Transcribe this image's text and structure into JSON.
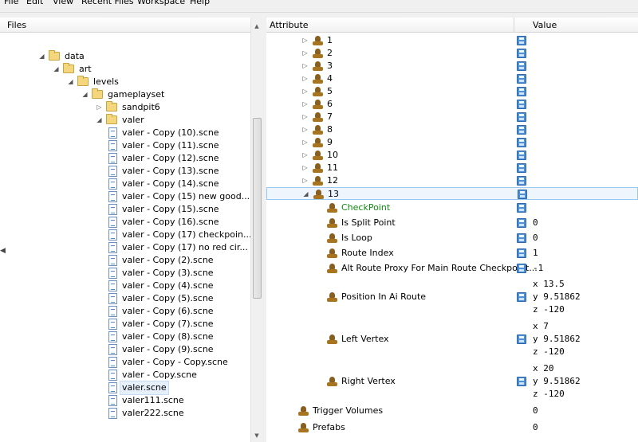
{
  "menubar": {
    "items": [
      "File",
      "Edit",
      "View",
      "Recent Files",
      "Workspace",
      "Help"
    ]
  },
  "files_panel": {
    "header": "Files",
    "tree": [
      {
        "label": "data",
        "type": "folder",
        "expanded": true
      },
      {
        "label": "art",
        "type": "folder",
        "expanded": true
      },
      {
        "label": "levels",
        "type": "folder",
        "expanded": true
      },
      {
        "label": "gameplayset",
        "type": "folder",
        "expanded": true
      },
      {
        "label": "sandpit6",
        "type": "folder",
        "expanded": false
      },
      {
        "label": "valer",
        "type": "folder",
        "expanded": true
      },
      {
        "label": "valer - Copy (10).scne",
        "type": "file"
      },
      {
        "label": "valer - Copy (11).scne",
        "type": "file"
      },
      {
        "label": "valer - Copy (12).scne",
        "type": "file"
      },
      {
        "label": "valer - Copy (13).scne",
        "type": "file"
      },
      {
        "label": "valer - Copy (14).scne",
        "type": "file"
      },
      {
        "label": "valer - Copy (15) new good...",
        "type": "file"
      },
      {
        "label": "valer - Copy (15).scne",
        "type": "file"
      },
      {
        "label": "valer - Copy (16).scne",
        "type": "file"
      },
      {
        "label": "valer - Copy (17) checkpoin...",
        "type": "file"
      },
      {
        "label": "valer - Copy (17) no red cir...",
        "type": "file"
      },
      {
        "label": "valer - Copy (2).scne",
        "type": "file"
      },
      {
        "label": "valer - Copy (3).scne",
        "type": "file"
      },
      {
        "label": "valer - Copy (4).scne",
        "type": "file"
      },
      {
        "label": "valer - Copy (5).scne",
        "type": "file"
      },
      {
        "label": "valer - Copy (6).scne",
        "type": "file"
      },
      {
        "label": "valer - Copy (7).scne",
        "type": "file"
      },
      {
        "label": "valer - Copy (8).scne",
        "type": "file"
      },
      {
        "label": "valer - Copy (9).scne",
        "type": "file"
      },
      {
        "label": "valer - Copy - Copy.scne",
        "type": "file"
      },
      {
        "label": "valer - Copy.scne",
        "type": "file"
      },
      {
        "label": "valer.scne",
        "type": "file",
        "selected": true
      },
      {
        "label": "valer111.scne",
        "type": "file"
      },
      {
        "label": "valer222.scne",
        "type": "file"
      }
    ]
  },
  "attributes_panel": {
    "columns": {
      "attribute": "Attribute",
      "value": "Value"
    },
    "rows": [
      {
        "label": "1",
        "arrow": "collapsed",
        "disk": true,
        "value": ""
      },
      {
        "label": "2",
        "arrow": "collapsed",
        "disk": true,
        "value": ""
      },
      {
        "label": "3",
        "arrow": "collapsed",
        "disk": true,
        "value": ""
      },
      {
        "label": "4",
        "arrow": "collapsed",
        "disk": true,
        "value": ""
      },
      {
        "label": "5",
        "arrow": "collapsed",
        "disk": true,
        "value": ""
      },
      {
        "label": "6",
        "arrow": "collapsed",
        "disk": true,
        "value": ""
      },
      {
        "label": "7",
        "arrow": "collapsed",
        "disk": true,
        "value": ""
      },
      {
        "label": "8",
        "arrow": "collapsed",
        "disk": true,
        "value": ""
      },
      {
        "label": "9",
        "arrow": "collapsed",
        "disk": true,
        "value": ""
      },
      {
        "label": "10",
        "arrow": "collapsed",
        "disk": true,
        "value": ""
      },
      {
        "label": "11",
        "arrow": "collapsed",
        "disk": true,
        "value": ""
      },
      {
        "label": "12",
        "arrow": "collapsed",
        "disk": true,
        "value": ""
      },
      {
        "label": "13",
        "arrow": "expanded",
        "disk": true,
        "value": "",
        "selected": true
      },
      {
        "label": "CheckPoint",
        "arrow": "none",
        "disk": true,
        "value": "",
        "green": true
      },
      {
        "label": "Is Split Point",
        "arrow": "none",
        "disk": true,
        "value": "0"
      },
      {
        "label": "Is Loop",
        "arrow": "none",
        "disk": true,
        "value": "0"
      },
      {
        "label": "Route Index",
        "arrow": "none",
        "disk": true,
        "value": "1"
      },
      {
        "label": "Alt Route Proxy For Main Route Checkpoint...",
        "arrow": "none",
        "disk": true,
        "value": "-1"
      },
      {
        "label": "Position In Ai Route",
        "arrow": "none",
        "disk": true,
        "value": "x 13.5\ny 9.51862\nz -120"
      },
      {
        "label": "Left Vertex",
        "arrow": "none",
        "disk": true,
        "value": "x 7\ny 9.51862\nz -120"
      },
      {
        "label": "Right Vertex",
        "arrow": "none",
        "disk": true,
        "value": "x 20\ny 9.51862\nz -120"
      },
      {
        "label": "Trigger Volumes",
        "arrow": "none",
        "disk": false,
        "value": "0"
      },
      {
        "label": "Prefabs",
        "arrow": "none",
        "disk": false,
        "value": "0"
      }
    ]
  },
  "icons": {
    "scroll_up": "scroll-up-arrow-icon",
    "scroll_down": "scroll-down-arrow-icon",
    "folder": "folder-icon",
    "file": "file-icon",
    "node": "node-icon",
    "disk": "save-disk-icon"
  }
}
